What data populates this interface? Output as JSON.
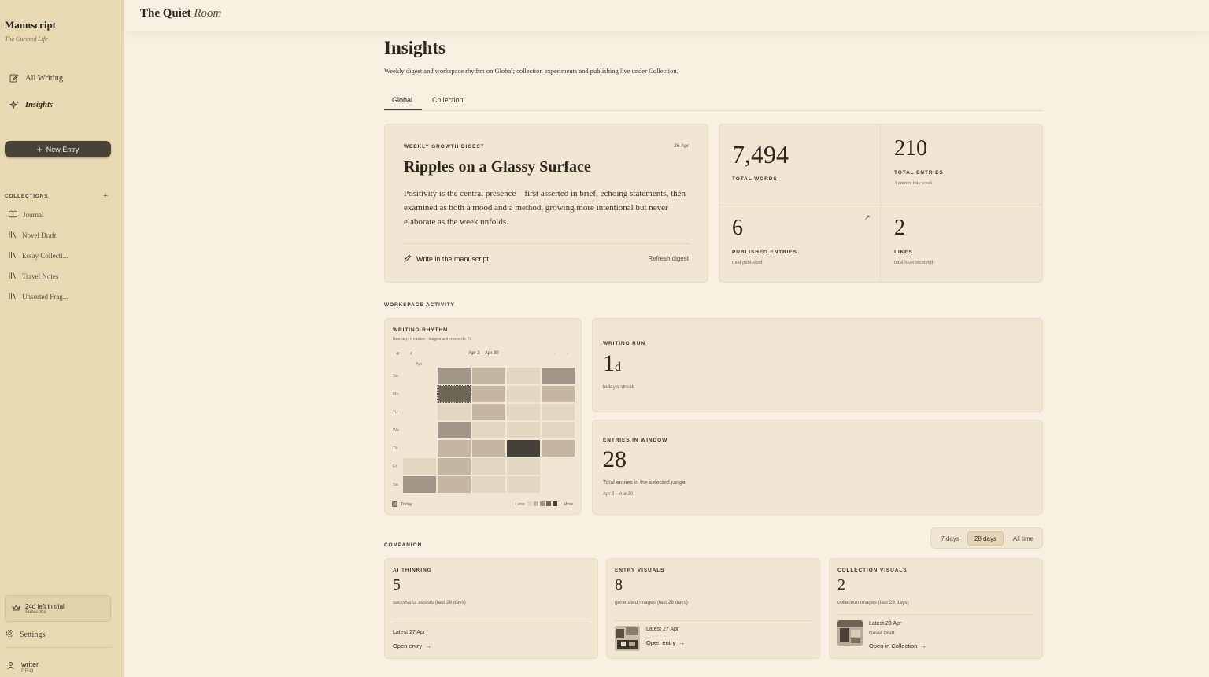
{
  "sidebar": {
    "brand": "Manuscript",
    "brand_sub": "The Curated Life",
    "nav": [
      {
        "label": "All Writing",
        "icon": "edit-icon"
      },
      {
        "label": "Insights",
        "icon": "sparkles-icon"
      }
    ],
    "new_entry": "New Entry",
    "collections_header": "COLLECTIONS",
    "collections": [
      {
        "label": "Journal",
        "icon": "book-icon"
      },
      {
        "label": "Novel Draft",
        "icon": "library-icon"
      },
      {
        "label": "Essay Collecti...",
        "icon": "library-icon"
      },
      {
        "label": "Travel Notes",
        "icon": "library-icon"
      },
      {
        "label": "Unsorted Frag...",
        "icon": "library-icon"
      }
    ],
    "trial": {
      "title": "24d left in trial",
      "action": "Subscribe"
    },
    "settings": "Settings",
    "user": {
      "name": "writer",
      "plan": "PRO"
    }
  },
  "topbar": {
    "title_main": "The Quiet",
    "title_italic": "Room"
  },
  "main": {
    "title": "Insights",
    "subtitle": "Weekly digest and workspace rhythm on Global; collection experiments and publishing live under Collection.",
    "tabs": [
      "Global",
      "Collection"
    ],
    "active_tab": "Global"
  },
  "digest": {
    "label": "WEEKLY GROWTH DIGEST",
    "date": "26 Apr",
    "title": "Ripples on a Glassy Surface",
    "body": "Positivity is the central presence—first asserted in brief, echoing statements, then examined as both a mood and a method, growing more intentional but never elaborate as the week unfolds.",
    "write_link": "Write in the manuscript",
    "refresh": "Refresh digest"
  },
  "stats": {
    "total_words": {
      "value": "7,494",
      "label": "TOTAL WORDS"
    },
    "total_entries": {
      "value": "210",
      "label": "TOTAL ENTRIES",
      "sub": "4 entries this week"
    },
    "published": {
      "value": "6",
      "label": "PUBLISHED ENTRIES",
      "sub": "total published"
    },
    "likes": {
      "value": "2",
      "label": "LIKES",
      "sub": "total likes received"
    }
  },
  "workspace": {
    "label": "WORKSPACE ACTIVITY",
    "rhythm": {
      "title": "WRITING RHYTHM",
      "sub": "Best day: 6 entries · longest active stretch: 7d",
      "range": "Apr 3 – Apr 30",
      "month": "Apr",
      "days": [
        "Su",
        "Mo",
        "Tu",
        "We",
        "Th",
        "Fr",
        "Sa"
      ],
      "today": "Today",
      "less": "Less",
      "more": "More",
      "levels": [
        [
          null,
          3,
          2,
          1,
          3
        ],
        [
          null,
          4,
          2,
          1,
          2
        ],
        [
          null,
          1,
          2,
          1,
          1
        ],
        [
          null,
          3,
          1,
          1,
          1
        ],
        [
          null,
          2,
          2,
          5,
          2
        ],
        [
          1,
          2,
          1,
          1,
          null
        ],
        [
          3,
          2,
          1,
          1,
          null
        ]
      ],
      "colors": [
        "#f1e8d6",
        "#e2d7c1",
        "#c3b7a2",
        "#a0968a",
        "#6e6658",
        "#45403a"
      ]
    },
    "run": {
      "label": "WRITING RUN",
      "value": "1",
      "unit": "d",
      "sub": "today's streak"
    },
    "window": {
      "label": "ENTRIES IN WINDOW",
      "value": "28",
      "sub": "Total entries in the selected range",
      "range": "Apr 3 – Apr 30"
    }
  },
  "companion": {
    "label": "COMPANION",
    "ranges": [
      "7 days",
      "28 days",
      "All time"
    ],
    "active_range": "28 days",
    "cards": [
      {
        "label": "AI THINKING",
        "value": "5",
        "sub": "successful assists (last 28 days)",
        "latest": "Latest 27 Apr",
        "link": "Open entry"
      },
      {
        "label": "ENTRY VISUALS",
        "value": "8",
        "sub": "generated images (last 28 days)",
        "latest": "Latest 27 Apr",
        "link": "Open entry"
      },
      {
        "label": "COLLECTION VISUALS",
        "value": "2",
        "sub": "collection images (last 28 days)",
        "latest": "Latest 23 Apr",
        "meta": "Novel Draft",
        "link": "Open in Collection"
      }
    ]
  }
}
